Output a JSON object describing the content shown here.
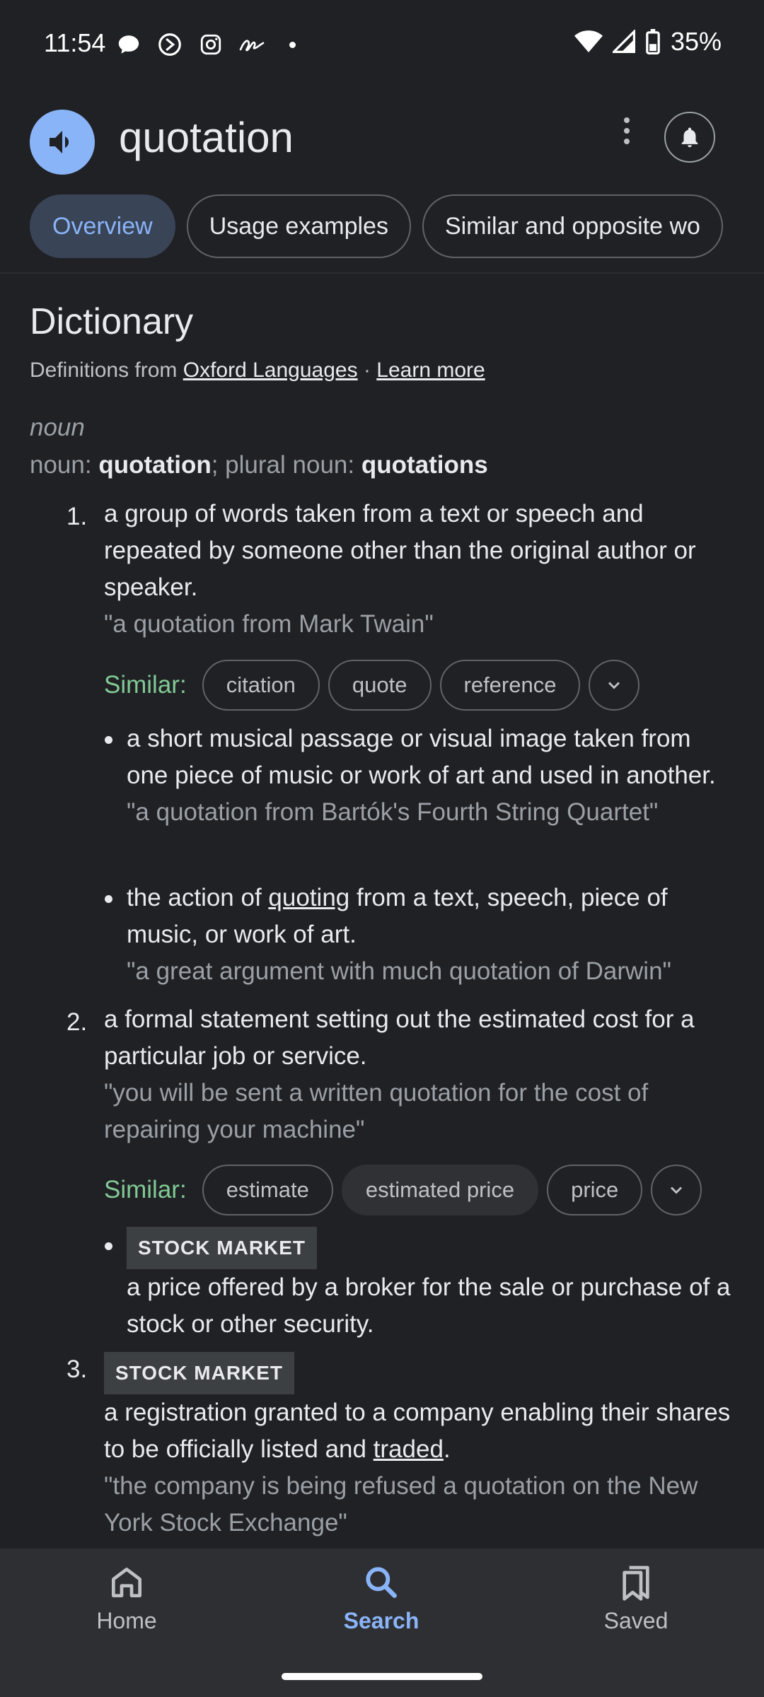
{
  "status_bar": {
    "time": "11:54",
    "battery": "35%"
  },
  "header": {
    "word": "quotation"
  },
  "tabs": [
    {
      "label": "Overview",
      "active": true
    },
    {
      "label": "Usage examples",
      "active": false
    },
    {
      "label": "Similar and opposite wo",
      "active": false
    }
  ],
  "dictionary": {
    "title": "Dictionary",
    "source_prefix": "Definitions from",
    "source_link": "Oxford Languages",
    "separator": "·",
    "learn_more": "Learn more",
    "part_of_speech": "noun",
    "forms_prefix": "noun:",
    "forms_word": "quotation",
    "forms_mid": "; plural noun:",
    "forms_plural": "quotations"
  },
  "senses": {
    "s1": {
      "num": "1.",
      "text": "a group of words taken from a text or speech and repeated by someone other than the original author or speaker.",
      "example": "\"a quotation from Mark Twain\"",
      "similar_label": "Similar:",
      "similar": [
        "citation",
        "quote",
        "reference"
      ],
      "sub1_text": "a short musical passage or visual image taken from one piece of music or work of art and used in another.",
      "sub1_example": "\"a quotation from Bartók's Fourth String Quartet\"",
      "sub2_pre": "the action of ",
      "sub2_link": "quoting",
      "sub2_post": " from a text, speech, piece of music, or work of art.",
      "sub2_example": "\"a great argument with much quotation of Darwin\""
    },
    "s2": {
      "num": "2.",
      "text": "a formal statement setting out the estimated cost for a particular job or service.",
      "example": "\"you will be sent a written quotation for the cost of repairing your machine\"",
      "similar_label": "Similar:",
      "similar": [
        "estimate",
        "estimated price",
        "price"
      ],
      "sub_tag": "STOCK MARKET",
      "sub_text": "a price offered by a broker for the sale or purchase of a stock or other security."
    },
    "s3": {
      "num": "3.",
      "tag": "STOCK MARKET",
      "text_pre": "a registration granted to a company enabling their shares to be officially listed and ",
      "text_link": "traded",
      "text_post": ".",
      "example": "\"the company is being refused a quotation on the New York Stock Exchange\""
    }
  },
  "bottom_nav": [
    {
      "label": "Home",
      "icon": "home-icon",
      "active": false
    },
    {
      "label": "Search",
      "icon": "search-icon",
      "active": true
    },
    {
      "label": "Saved",
      "icon": "saved-icon",
      "active": false
    }
  ],
  "colors": {
    "background": "#202124",
    "accent": "#8ab4f8",
    "similar": "#81c995"
  }
}
